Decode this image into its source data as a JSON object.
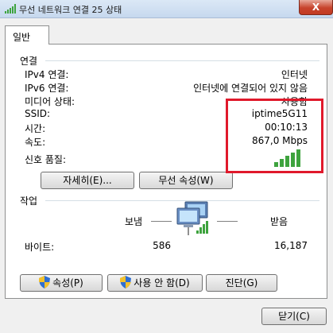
{
  "window": {
    "title": "무선 네트워크 연결 25 상태",
    "close_label": "X"
  },
  "tabs": [
    {
      "label": "일반"
    }
  ],
  "connection": {
    "section_label": "연결",
    "rows": [
      {
        "label": "IPv4 연결:",
        "value": "인터넷"
      },
      {
        "label": "IPv6 연결:",
        "value": "인터넷에 연결되어 있지 않음"
      },
      {
        "label": "미디어 상태:",
        "value": "사용함"
      },
      {
        "label": "SSID:",
        "value": "iptime5G11"
      },
      {
        "label": "시간:",
        "value": "00:10:13"
      },
      {
        "label": "속도:",
        "value": "867,0 Mbps"
      }
    ],
    "signal_label": "신호 품질:",
    "signal_bars": 5,
    "signal_color": "#3ea33e"
  },
  "buttons": {
    "details": "자세히(E)...",
    "wireless_props": "무선 속성(W)",
    "properties": "속성(P)",
    "disable": "사용 안 함(D)",
    "diagnose": "진단(G)",
    "close": "닫기(C)"
  },
  "activity": {
    "section_label": "작업",
    "sent_label": "보냄",
    "received_label": "받음",
    "bytes_label": "바이트:",
    "bytes_sent": "586",
    "bytes_received": "16,187"
  },
  "colors": {
    "highlight_box": "#e0192b",
    "shield_blue": "#2f6fd1",
    "shield_yellow": "#f2c12e"
  }
}
